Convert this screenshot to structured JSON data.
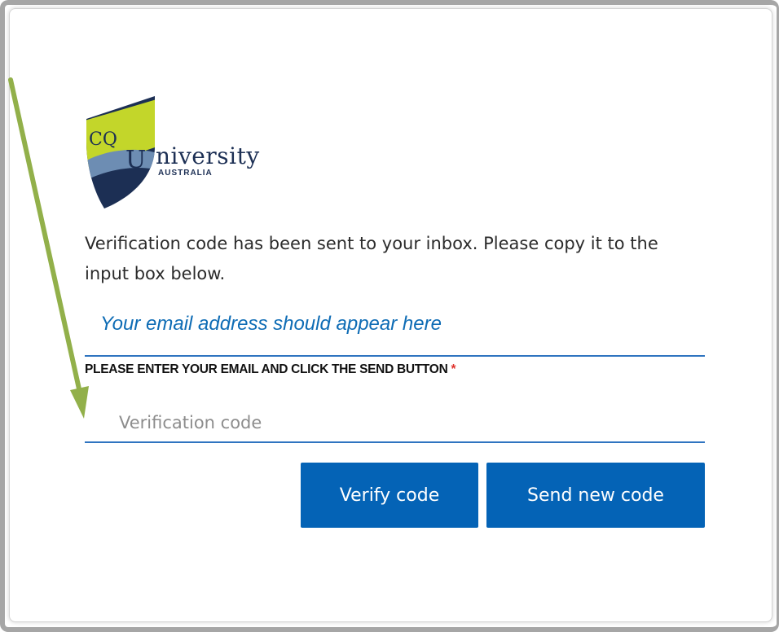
{
  "logo": {
    "name": "university-logo",
    "wordmark_prefix": "CQ",
    "wordmark_U": "U",
    "wordmark_rest": "niversity",
    "subtext": "AUSTRALIA",
    "colors": {
      "navy": "#1c2f54",
      "lime": "#c3d62a",
      "steel": "#6d8db3"
    }
  },
  "intro_text": "Verification code has been sent to your inbox. Please copy it to the input box below.",
  "email_note": "Your email address should appear here",
  "field": {
    "label": "PLEASE ENTER YOUR EMAIL AND CLICK THE SEND BUTTON",
    "required_marker": "*",
    "placeholder": "Verification code",
    "value": ""
  },
  "buttons": {
    "verify": "Verify code",
    "send_new": "Send new code"
  },
  "annotation": {
    "icon": "arrow-icon",
    "color": "#92b04a"
  },
  "colors": {
    "accent": "#0463b6",
    "underline": "#2f74c0",
    "note": "#0e6cb5",
    "required": "#e0342e"
  }
}
